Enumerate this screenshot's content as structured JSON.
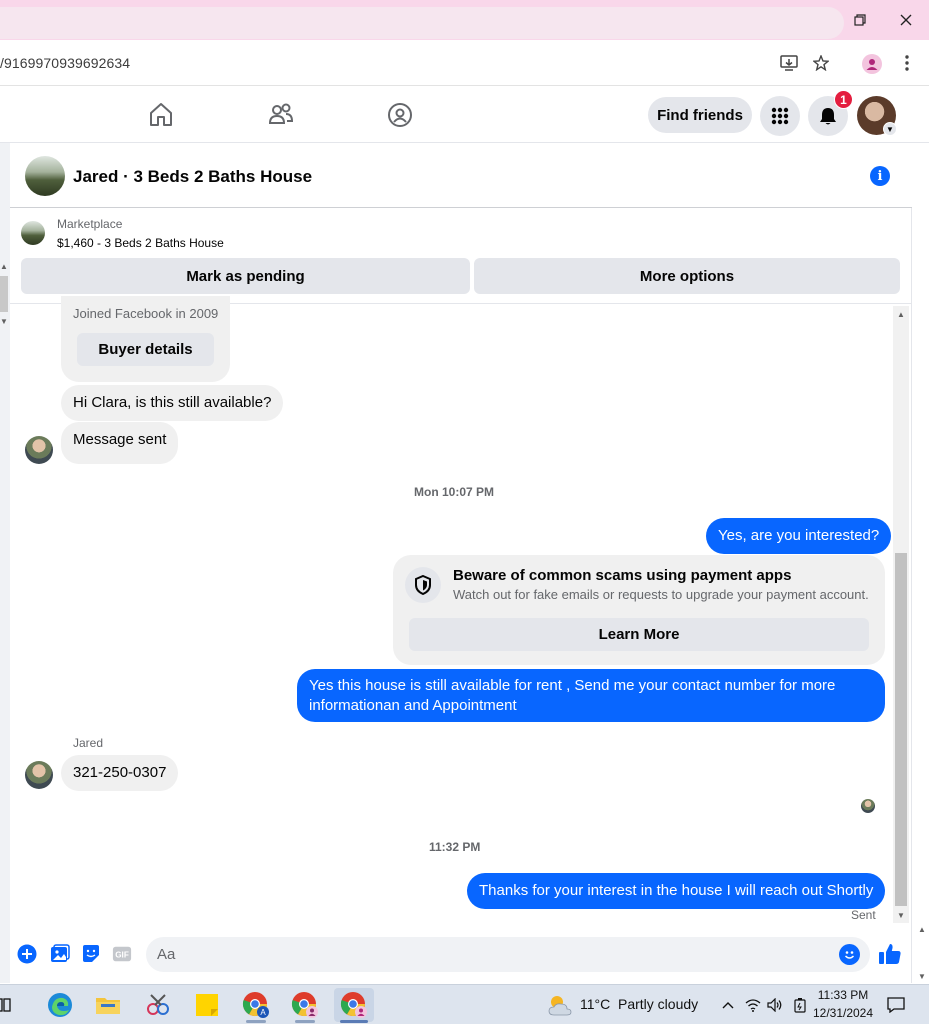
{
  "browser": {
    "url": "/9169970939692634",
    "window_controls": [
      "minimize",
      "restore",
      "close"
    ]
  },
  "nav": {
    "find_friends": "Find friends",
    "notification_count": "1"
  },
  "chat": {
    "title": "Jared · 3 Beds 2 Baths House",
    "marketplace_label": "Marketplace",
    "listing": "$1,460 - 3 Beds 2 Baths House",
    "mark_pending": "Mark as pending",
    "more_options": "More options",
    "joined": "Joined Facebook in 2009",
    "buyer_details": "Buyer details",
    "messages": [
      {
        "from": "them",
        "text": "Hi Clara, is this still available?"
      },
      {
        "from": "them",
        "text": "Message sent"
      },
      {
        "from": "me",
        "text": "Yes, are you interested?"
      },
      {
        "from": "me",
        "text": "Yes this house is still available for rent , Send me your contact number for more"
      },
      {
        "from": "me",
        "text": "informationan and Appointment"
      },
      {
        "from": "them",
        "text": "321-250-0307"
      },
      {
        "from": "me",
        "text": "Thanks for your interest in the house I will reach out Shortly"
      }
    ],
    "timestamp_1": "Mon 10:07 PM",
    "timestamp_2": "11:32 PM",
    "scam_title": "Beware of common scams using payment apps",
    "scam_sub": "Watch out for fake emails or requests to upgrade your payment account.",
    "learn_more": "Learn More",
    "sender_name": "Jared",
    "sent_status": "Sent",
    "composer_placeholder": "Aa"
  },
  "taskbar": {
    "temperature": "11°C",
    "weather": "Partly cloudy",
    "time": "11:33 PM",
    "date": "12/31/2024"
  },
  "colors": {
    "accent": "#0866ff",
    "titlebar": "#f9d7ea",
    "notification": "#e41e3f"
  }
}
